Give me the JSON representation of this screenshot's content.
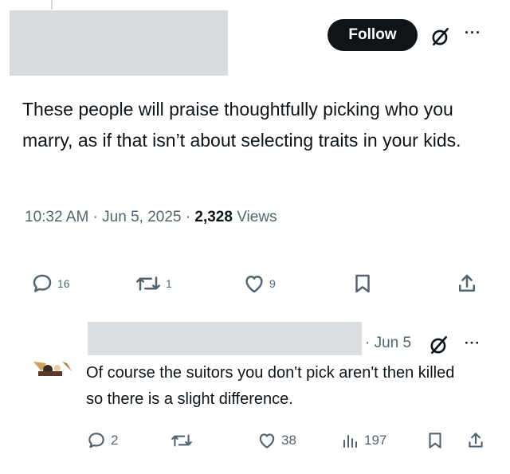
{
  "tweet": {
    "follow_label": "Follow",
    "more_glyph": "···",
    "text": "These people will praise thoughtfully picking who you marry, as if that isn’t about selecting traits in your kids.",
    "time": "10:32 AM",
    "date": "Jun 5, 2025",
    "views_count": "2,328",
    "views_label": "Views",
    "actions": {
      "replies": "16",
      "retweets": "1",
      "likes": "9"
    },
    "icons": [
      "reply-icon",
      "retweet-icon",
      "like-icon",
      "bookmark-icon",
      "share-icon",
      "grok-icon",
      "more-icon"
    ]
  },
  "reply": {
    "date": "Jun 5",
    "more_glyph": "···",
    "text": "Of course the suitors you don't pick aren't then killed so there is a slight difference.",
    "actions": {
      "replies": "2",
      "likes": "38",
      "views": "197"
    }
  },
  "colors": {
    "text": "#0f1419",
    "muted": "#536471",
    "button_bg": "#0f1419",
    "redaction": "#d9dcde"
  }
}
